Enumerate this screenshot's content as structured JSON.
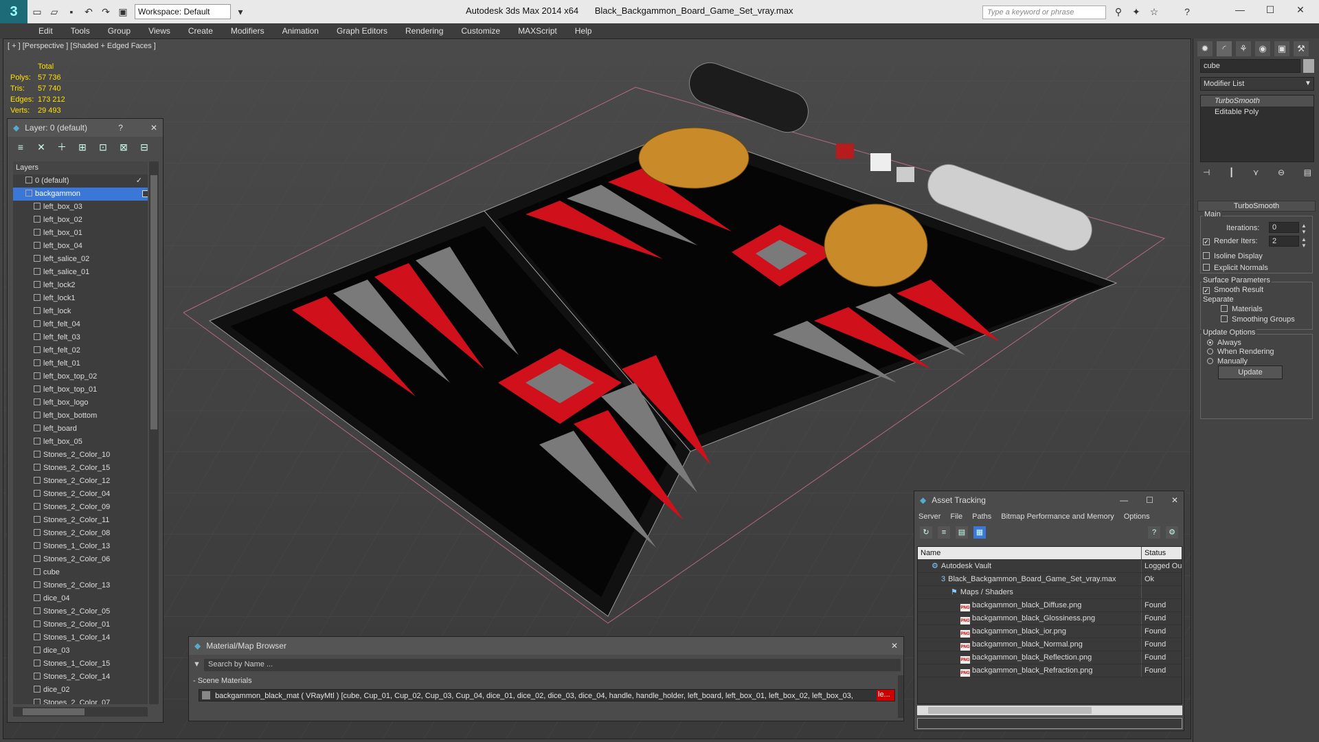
{
  "titlebar": {
    "workspace": "Workspace: Default",
    "app": "Autodesk 3ds Max  2014 x64",
    "file": "Black_Backgammon_Board_Game_Set_vray.max",
    "search_placeholder": "Type a keyword or phrase"
  },
  "menu": [
    "Edit",
    "Tools",
    "Group",
    "Views",
    "Create",
    "Modifiers",
    "Animation",
    "Graph Editors",
    "Rendering",
    "Customize",
    "MAXScript",
    "Help"
  ],
  "viewport": {
    "label": "[ + ] [Perspective ] [Shaded + Edged Faces ]",
    "stats": {
      "total_label": "Total",
      "polys_label": "Polys:",
      "polys": "57 736",
      "tris_label": "Tris:",
      "tris": "57 740",
      "edges_label": "Edges:",
      "edges": "173 212",
      "verts_label": "Verts:",
      "verts": "29 493"
    }
  },
  "layer_window": {
    "title": "Layer: 0 (default)",
    "help": "?",
    "list_header": "Layers",
    "layers": [
      {
        "name": "0 (default)",
        "indent": 1,
        "selected": false
      },
      {
        "name": "backgammon",
        "indent": 1,
        "selected": true
      },
      {
        "name": "left_box_03",
        "indent": 2
      },
      {
        "name": "left_box_02",
        "indent": 2
      },
      {
        "name": "left_box_01",
        "indent": 2
      },
      {
        "name": "left_box_04",
        "indent": 2
      },
      {
        "name": "left_salice_02",
        "indent": 2
      },
      {
        "name": "left_salice_01",
        "indent": 2
      },
      {
        "name": "left_lock2",
        "indent": 2
      },
      {
        "name": "left_lock1",
        "indent": 2
      },
      {
        "name": "left_lock",
        "indent": 2
      },
      {
        "name": "left_felt_04",
        "indent": 2
      },
      {
        "name": "left_felt_03",
        "indent": 2
      },
      {
        "name": "left_felt_02",
        "indent": 2
      },
      {
        "name": "left_felt_01",
        "indent": 2
      },
      {
        "name": "left_box_top_02",
        "indent": 2
      },
      {
        "name": "left_box_top_01",
        "indent": 2
      },
      {
        "name": "left_box_logo",
        "indent": 2
      },
      {
        "name": "left_box_bottom",
        "indent": 2
      },
      {
        "name": "left_board",
        "indent": 2
      },
      {
        "name": "left_box_05",
        "indent": 2
      },
      {
        "name": "Stones_2_Color_10",
        "indent": 2
      },
      {
        "name": "Stones_2_Color_15",
        "indent": 2
      },
      {
        "name": "Stones_2_Color_12",
        "indent": 2
      },
      {
        "name": "Stones_2_Color_04",
        "indent": 2
      },
      {
        "name": "Stones_2_Color_09",
        "indent": 2
      },
      {
        "name": "Stones_2_Color_11",
        "indent": 2
      },
      {
        "name": "Stones_2_Color_08",
        "indent": 2
      },
      {
        "name": "Stones_1_Color_13",
        "indent": 2
      },
      {
        "name": "Stones_2_Color_06",
        "indent": 2
      },
      {
        "name": "cube",
        "indent": 2
      },
      {
        "name": "Stones_2_Color_13",
        "indent": 2
      },
      {
        "name": "dice_04",
        "indent": 2
      },
      {
        "name": "Stones_2_Color_05",
        "indent": 2
      },
      {
        "name": "Stones_2_Color_01",
        "indent": 2
      },
      {
        "name": "Stones_1_Color_14",
        "indent": 2
      },
      {
        "name": "dice_03",
        "indent": 2
      },
      {
        "name": "Stones_1_Color_15",
        "indent": 2
      },
      {
        "name": "Stones_2_Color_14",
        "indent": 2
      },
      {
        "name": "dice_02",
        "indent": 2
      },
      {
        "name": "Stones_2_Color_07",
        "indent": 2
      }
    ]
  },
  "command_panel": {
    "object_name": "cube",
    "modifier_list": "Modifier List",
    "stack": [
      "TurboSmooth",
      "Editable Poly"
    ],
    "rollout_title": "TurboSmooth",
    "main_label": "Main",
    "iterations_label": "Iterations:",
    "iterations": "0",
    "render_iters_label": "Render Iters:",
    "render_iters": "2",
    "isoline_label": "Isoline Display",
    "explicit_label": "Explicit Normals",
    "surface_label": "Surface Parameters",
    "smooth_label": "Smooth Result",
    "separate_label": "Separate",
    "materials_label": "Materials",
    "smoothing_label": "Smoothing Groups",
    "update_options_label": "Update Options",
    "always_label": "Always",
    "when_rendering_label": "When Rendering",
    "manually_label": "Manually",
    "update_button": "Update"
  },
  "material_browser": {
    "title": "Material/Map Browser",
    "search_placeholder": "Search by Name ...",
    "section": "- Scene Materials",
    "material_row": "backgammon_black_mat  ( VRayMtl )  [cube, Cup_01, Cup_02, Cup_03, Cup_04, dice_01, dice_02, dice_03, dice_04, handle, handle_holder, left_board, left_box_01, left_box_02, left_box_03,",
    "material_row_end": "le..."
  },
  "asset_tracking": {
    "title": "Asset Tracking",
    "menu": [
      "Server",
      "File",
      "Paths",
      "Bitmap Performance and Memory",
      "Options"
    ],
    "col_name": "Name",
    "col_status": "Status",
    "rows": [
      {
        "name": "Autodesk Vault",
        "status": "Logged Out",
        "indent": 1,
        "kind": "vault"
      },
      {
        "name": "Black_Backgammon_Board_Game_Set_vray.max",
        "status": "Ok",
        "indent": 2,
        "kind": "max"
      },
      {
        "name": "Maps / Shaders",
        "status": "",
        "indent": 3,
        "kind": "maps"
      },
      {
        "name": "backgammon_black_Diffuse.png",
        "status": "Found",
        "indent": 4,
        "kind": "png"
      },
      {
        "name": "backgammon_black_Glossiness.png",
        "status": "Found",
        "indent": 4,
        "kind": "png"
      },
      {
        "name": "backgammon_black_ior.png",
        "status": "Found",
        "indent": 4,
        "kind": "png"
      },
      {
        "name": "backgammon_black_Normal.png",
        "status": "Found",
        "indent": 4,
        "kind": "png"
      },
      {
        "name": "backgammon_black_Reflection.png",
        "status": "Found",
        "indent": 4,
        "kind": "png"
      },
      {
        "name": "backgammon_black_Refraction.png",
        "status": "Found",
        "indent": 4,
        "kind": "png"
      }
    ]
  },
  "colors": {
    "selection": "#3a77d6",
    "stats": "#ffe100",
    "felt_red": "#d0101a",
    "felt_gray": "#7a7a7a",
    "cup": "#c98a2a"
  }
}
